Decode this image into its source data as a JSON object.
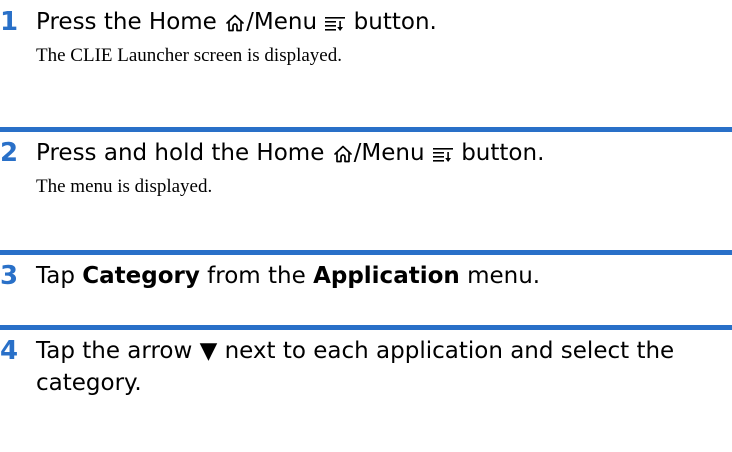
{
  "colors": {
    "accent": "#2970c8",
    "text": "#000000"
  },
  "steps": [
    {
      "number": "1",
      "text_a": "Press the Home ",
      "text_b": "/Menu ",
      "text_c": " button.",
      "result": "The CLIE Launcher screen is displayed."
    },
    {
      "number": "2",
      "text_a": "Press and hold the Home ",
      "text_b": "/Menu ",
      "text_c": " button.",
      "result": "The menu is displayed."
    },
    {
      "number": "3",
      "text_a": "Tap ",
      "bold_a": "Category",
      "text_b": " from the ",
      "bold_b": "Application",
      "text_c": " menu."
    },
    {
      "number": "4",
      "text_a": "Tap the arrow ▼ next to each application and select the category."
    }
  ]
}
